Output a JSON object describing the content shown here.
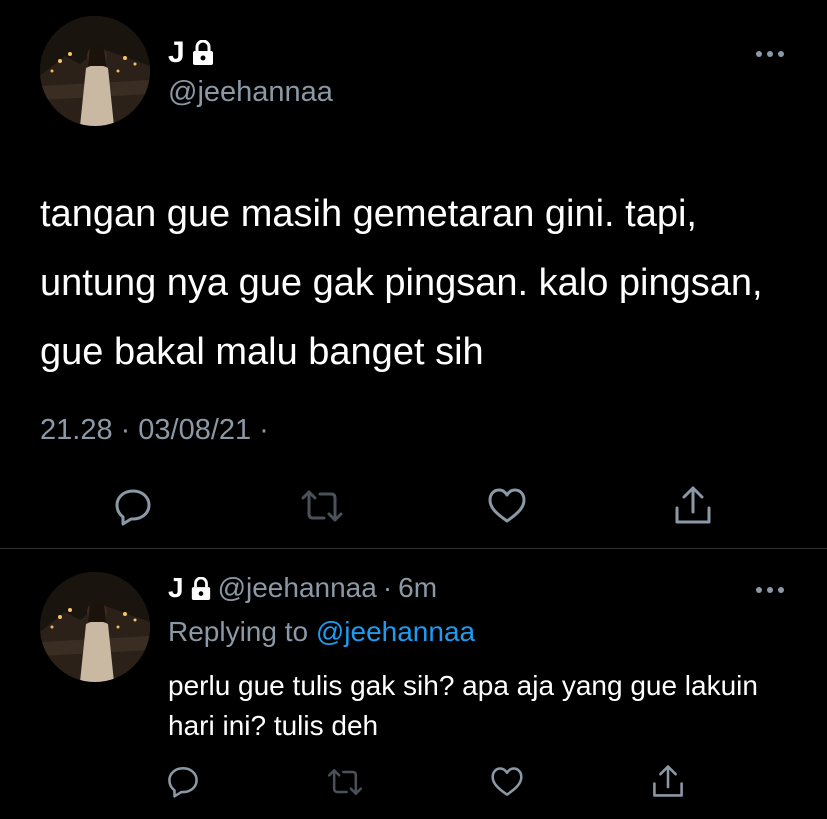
{
  "main_tweet": {
    "display_name": "J",
    "handle": "@jeehannaa",
    "text": "tangan gue masih gemetaran gini. tapi, untung nya gue gak pingsan. kalo pingsan, gue bakal malu banget sih",
    "time": "21.28",
    "separator": "·",
    "date": "03/08/21",
    "separator2": "·"
  },
  "reply_tweet": {
    "display_name": "J",
    "handle": "@jeehannaa",
    "separator": "·",
    "time": "6m",
    "replying_prefix": "Replying to",
    "replying_handle": "@jeehannaa",
    "text": "perlu gue tulis gak sih? apa aja yang gue lakuin hari ini? tulis deh"
  },
  "icons": {
    "lock": "lock-icon",
    "more": "more-icon",
    "reply": "reply-icon",
    "retweet": "retweet-icon",
    "like": "like-icon",
    "share": "share-icon"
  },
  "colors": {
    "background": "#000000",
    "text": "#ffffff",
    "muted": "#8b98a5",
    "link": "#1d9bf0",
    "icon": "#8b98a5",
    "icon_dim": "#4a5158",
    "divider": "#2f3336"
  }
}
